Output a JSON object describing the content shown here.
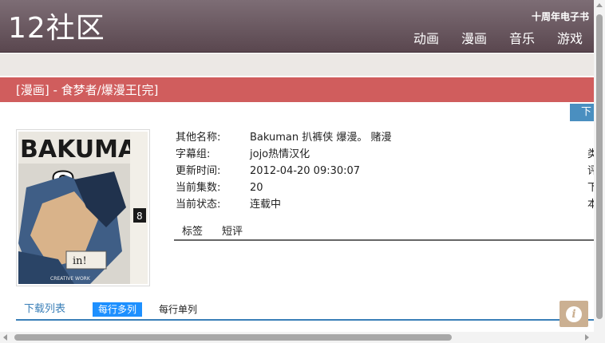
{
  "header": {
    "logo": "12社区",
    "ebook_link": "十周年电子书",
    "nav": [
      "动画",
      "漫画",
      "音乐",
      "游戏"
    ]
  },
  "title_bar": {
    "title": "[漫画] - 食梦者/爆漫王[完]"
  },
  "download_button": "下",
  "cover": {
    "title_text": "BAKUMAN",
    "volume": "8",
    "icon": "manga-cover-image"
  },
  "info": {
    "rows": [
      {
        "label": "其他名称:",
        "value": "Bakuman 扒裤侠 爆漫。 赌漫"
      },
      {
        "label": "字幕组:",
        "value": "jojo热情汉化"
      },
      {
        "label": "更新时间:",
        "value": "2012-04-20 09:30:07"
      },
      {
        "label": "当前集数:",
        "value": "20"
      },
      {
        "label": "当前状态:",
        "value": "连载中"
      }
    ],
    "cut_labels": [
      "类",
      "评",
      "下",
      "本"
    ]
  },
  "tabs": [
    "标签",
    "短评"
  ],
  "download_list": {
    "title": "下载列表",
    "options": [
      "每行多列",
      "每行单列"
    ],
    "active_option": "每行多列"
  },
  "info_badge": {
    "glyph": "i",
    "icon": "info-icon"
  },
  "colors": {
    "header": "#6b5a62",
    "title_bar": "#d05d5d",
    "accent_blue": "#3a7fb8",
    "active_option": "#1e90ff",
    "badge": "#cbb092"
  }
}
